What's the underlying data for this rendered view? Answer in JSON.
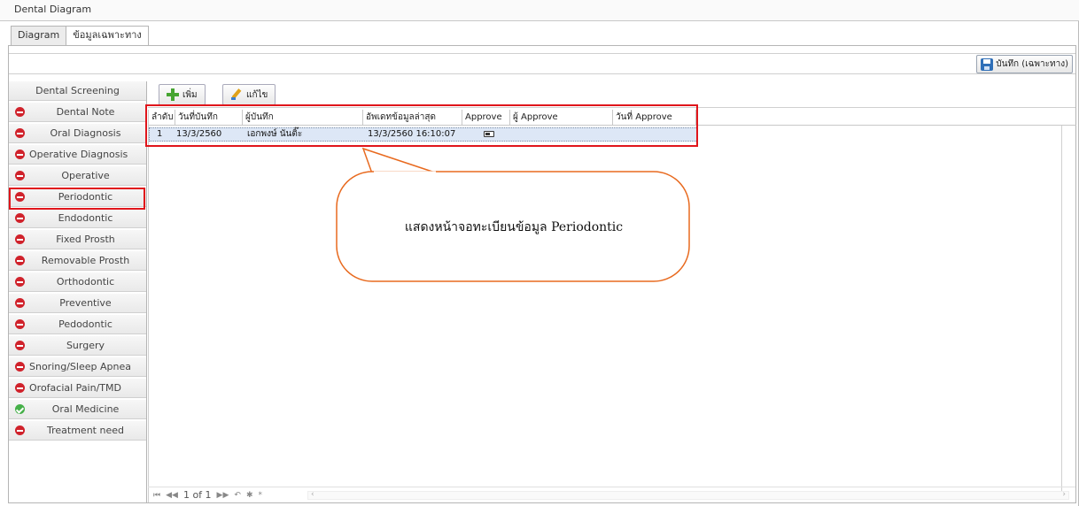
{
  "window": {
    "title": "Dental Diagram"
  },
  "tabs": [
    {
      "label": "Diagram",
      "active": false
    },
    {
      "label": "ข้อมูลเฉพาะทาง",
      "active": true
    }
  ],
  "toolbar": {
    "save_label": "บันทึก (เฉพาะทาง)",
    "save_icon": "floppy-disk-icon"
  },
  "sidebar": {
    "items": [
      {
        "label": "Dental Screening",
        "status": "none"
      },
      {
        "label": "Dental Note",
        "status": "red"
      },
      {
        "label": "Oral Diagnosis",
        "status": "red"
      },
      {
        "label": "Operative Diagnosis",
        "status": "red"
      },
      {
        "label": "Operative",
        "status": "red"
      },
      {
        "label": "Periodontic",
        "status": "red",
        "selected": true
      },
      {
        "label": "Endodontic",
        "status": "red"
      },
      {
        "label": "Fixed Prosth",
        "status": "red"
      },
      {
        "label": "Removable Prosth",
        "status": "red"
      },
      {
        "label": "Orthodontic",
        "status": "red"
      },
      {
        "label": "Preventive",
        "status": "red"
      },
      {
        "label": "Pedodontic",
        "status": "red"
      },
      {
        "label": "Surgery",
        "status": "red"
      },
      {
        "label": "Snoring/Sleep Apnea",
        "status": "red"
      },
      {
        "label": "Orofacial Pain/TMD",
        "status": "red"
      },
      {
        "label": "Oral Medicine",
        "status": "green"
      },
      {
        "label": "Treatment need",
        "status": "red"
      }
    ]
  },
  "actions": {
    "add_label": "เพิ่ม",
    "edit_label": "แก้ไข"
  },
  "grid": {
    "columns": [
      "ลำดับ",
      "วันที่บันทึก",
      "ผู้บันทึก",
      "อัพเดทข้อมูลล่าสุด",
      "Approve",
      "ผู้ Approve",
      "วันที่ Approve"
    ],
    "rows": [
      {
        "no": "1",
        "date": "13/3/2560",
        "recorder": "เอกพงษ์ นันติ๊ะ",
        "updated": "13/3/2560 16:10:07",
        "approve": "toggle-icon",
        "approver": "",
        "approve_date": ""
      }
    ]
  },
  "pager": {
    "text": "1 of 1"
  },
  "callout": {
    "text": "แสดงหน้าจอทะเบียนข้อมูล Periodontic"
  },
  "colors": {
    "highlight": "#e0151b",
    "callout_border": "#e86a1f",
    "row_selected": "#dde7f6",
    "status_red": "#d0222b",
    "status_green": "#45b049"
  }
}
